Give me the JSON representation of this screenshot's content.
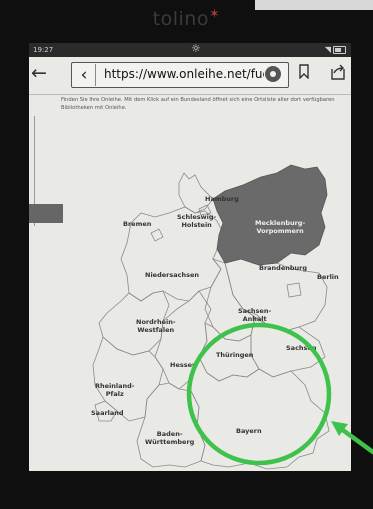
{
  "device": {
    "brand": "tolino"
  },
  "statusbar": {
    "time": "19:27"
  },
  "browser": {
    "url": "https://www.onleihe.net/fuer-"
  },
  "intro_text": "Finden Sie Ihre Onleihe. Mit dem Klick auf ein Bundesland öffnet sich eine Ortsliste aller dort verfügbaren Bibliotheken mit Onleihe.",
  "map": {
    "states": [
      {
        "name": "Hamburg",
        "lines": [
          "Hamburg"
        ],
        "highlighted": false
      },
      {
        "name": "Schleswig-Holstein",
        "lines": [
          "Schleswig-",
          "Holstein"
        ],
        "highlighted": false
      },
      {
        "name": "Bremen",
        "lines": [
          "Bremen"
        ],
        "highlighted": false
      },
      {
        "name": "Mecklenburg-Vorpommern",
        "lines": [
          "Mecklenburg-",
          "Vorpommern"
        ],
        "highlighted": true
      },
      {
        "name": "Niedersachsen",
        "lines": [
          "Niedersachsen"
        ],
        "highlighted": false
      },
      {
        "name": "Brandenburg",
        "lines": [
          "Brandenburg"
        ],
        "highlighted": false
      },
      {
        "name": "Berlin",
        "lines": [
          "Berlin"
        ],
        "highlighted": false
      },
      {
        "name": "Sachsen-Anhalt",
        "lines": [
          "Sachsen-",
          "Anhalt"
        ],
        "highlighted": false
      },
      {
        "name": "Nordrhein-Westfalen",
        "lines": [
          "Nordrhein-",
          "Westfalen"
        ],
        "highlighted": false
      },
      {
        "name": "Sachsen",
        "lines": [
          "Sachsen"
        ],
        "highlighted": false
      },
      {
        "name": "Hessen",
        "lines": [
          "Hessen"
        ],
        "highlighted": false
      },
      {
        "name": "Thüringen",
        "lines": [
          "Thüringen"
        ],
        "highlighted": false
      },
      {
        "name": "Rheinland-Pfalz",
        "lines": [
          "Rheinland-",
          "Pfalz"
        ],
        "highlighted": false
      },
      {
        "name": "Saarland",
        "lines": [
          "Saarland"
        ],
        "highlighted": false
      },
      {
        "name": "Bayern",
        "lines": [
          "Bayern"
        ],
        "highlighted": false
      },
      {
        "name": "Baden-Württemberg",
        "lines": [
          "Baden-",
          "Württemberg"
        ],
        "highlighted": false
      }
    ]
  },
  "annotation": {
    "color": "#3fc24c",
    "circled_state": "Bayern"
  },
  "colors": {
    "highlight_fill": "#6a6a6a",
    "screen": "#e9e9e6"
  }
}
